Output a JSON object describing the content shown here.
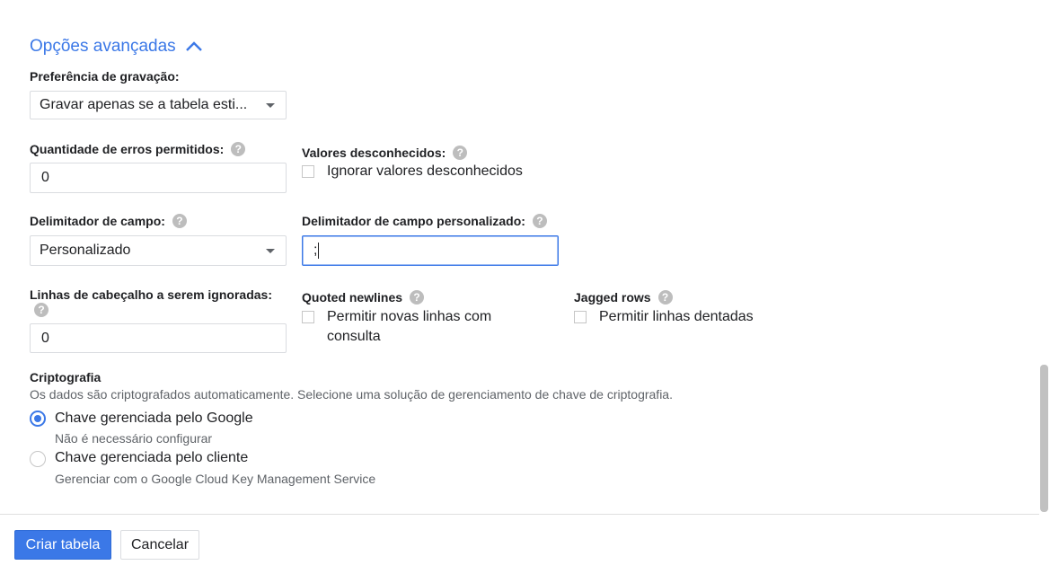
{
  "advanced": {
    "title": "Opções avançadas",
    "toggle_icon": "chevron-up-icon"
  },
  "write_preference": {
    "label": "Preferência de gravação:",
    "value": "Gravar apenas se a tabela esti..."
  },
  "errors_allowed": {
    "label": "Quantidade de erros permitidos:",
    "value": "0"
  },
  "unknown_values": {
    "label": "Valores desconhecidos:",
    "checkbox_label": "Ignorar valores desconhecidos",
    "checked": false
  },
  "field_delimiter": {
    "label": "Delimitador de campo:",
    "value": "Personalizado"
  },
  "custom_delimiter": {
    "label": "Delimitador de campo personalizado:",
    "value": ";"
  },
  "header_rows": {
    "label": "Linhas de cabeçalho a serem ignoradas:",
    "value": "0"
  },
  "quoted_newlines": {
    "label": "Quoted newlines",
    "checkbox_label": "Permitir novas linhas com consulta",
    "checked": false
  },
  "jagged_rows": {
    "label": "Jagged rows",
    "checkbox_label": "Permitir linhas dentadas",
    "checked": false
  },
  "encryption": {
    "title": "Criptografia",
    "description": "Os dados são criptografados automaticamente. Selecione uma solução de gerenciamento de chave de criptografia.",
    "options": [
      {
        "label": "Chave gerenciada pelo Google",
        "sub": "Não é necessário configurar",
        "selected": true
      },
      {
        "label": "Chave gerenciada pelo cliente",
        "sub": "Gerenciar com o Google Cloud Key Management Service",
        "selected": false
      }
    ]
  },
  "help_icon_glyph": "?",
  "footer": {
    "create_label": "Criar tabela",
    "cancel_label": "Cancelar"
  },
  "colors": {
    "accent": "#3b78e7",
    "text": "#202124",
    "muted": "#5f6368",
    "border": "#dadce0"
  }
}
